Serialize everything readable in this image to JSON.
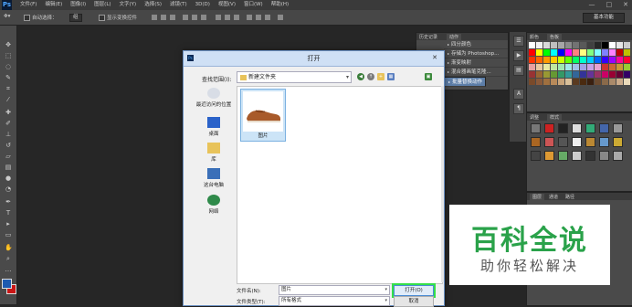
{
  "app": {
    "logo": "Ps",
    "menu": [
      "文件(F)",
      "编辑(E)",
      "图像(I)",
      "图层(L)",
      "文字(Y)",
      "选择(S)",
      "滤镜(T)",
      "3D(D)",
      "视图(V)",
      "窗口(W)",
      "帮助(H)"
    ],
    "window_controls": [
      "—",
      "□",
      "✕"
    ]
  },
  "options_bar": {
    "auto_select_label": "自动选择：",
    "auto_select_value": "组",
    "show_transform_label": "显示变换控件",
    "workspace": "基本功能"
  },
  "actions_panel": {
    "tabs": [
      "历史记录",
      "动作"
    ],
    "items": [
      {
        "label": "四分颜色",
        "selected": false
      },
      {
        "label": "存储为 Photoshop...",
        "selected": false
      },
      {
        "label": "渐变映射",
        "selected": false
      },
      {
        "label": "混合器画笔克隆...",
        "selected": false
      },
      {
        "label": "批量替换动作",
        "selected": true
      }
    ]
  },
  "swatches_panel": {
    "tabs": [
      "颜色",
      "色板"
    ],
    "colors": [
      "#ffffff",
      "#f2f2f2",
      "#d9d9d9",
      "#bfbfbf",
      "#a6a6a6",
      "#8c8c8c",
      "#737373",
      "#595959",
      "#404040",
      "#262626",
      "#000000",
      "#ffffff",
      "#e6e6e6",
      "#cccccc",
      "#ff0000",
      "#ffff00",
      "#00ff00",
      "#00ffff",
      "#0000ff",
      "#ff00ff",
      "#ff8080",
      "#ffff80",
      "#80ff80",
      "#80ffff",
      "#8080ff",
      "#ff80ff",
      "#c00000",
      "#c0c000",
      "#ff3300",
      "#ff6600",
      "#ff9900",
      "#ffcc00",
      "#ccff00",
      "#66ff00",
      "#00ff66",
      "#00ffcc",
      "#00ccff",
      "#0066ff",
      "#3300ff",
      "#9900ff",
      "#ff0099",
      "#ff0033",
      "#e8a0a0",
      "#e8c8a0",
      "#e8e8a0",
      "#c0e8a0",
      "#a0e8b0",
      "#a0e8e8",
      "#a0c0e8",
      "#a0a0e8",
      "#c8a0e8",
      "#e8a0d0",
      "#cc3333",
      "#cc6633",
      "#cc9933",
      "#99cc33",
      "#993333",
      "#996633",
      "#999933",
      "#669933",
      "#339966",
      "#339999",
      "#336699",
      "#333399",
      "#663399",
      "#993366",
      "#cc0066",
      "#990033",
      "#660033",
      "#330066",
      "#7a4a2a",
      "#8a5a3a",
      "#a0703f",
      "#b88a5a",
      "#c8a47a",
      "#d9c09a",
      "#5a3a20",
      "#4a2a10",
      "#3a2010",
      "#6a4a30",
      "#8a6a4a",
      "#aa8a6a",
      "#caaa8a",
      "#eadaba"
    ]
  },
  "styles_panel": {
    "tabs": [
      "调整",
      "样式"
    ]
  },
  "layers_panel": {
    "tabs": [
      "图层",
      "通道",
      "路径"
    ]
  },
  "dialog": {
    "title": "打开",
    "close": "✕",
    "look_in_label": "查找范围(I):",
    "look_in_value": "新建文件夹",
    "places": [
      {
        "label": "最近访问的位置",
        "icon": "recent-places-icon"
      },
      {
        "label": "桌面",
        "icon": "desktop-icon"
      },
      {
        "label": "库",
        "icon": "libraries-icon"
      },
      {
        "label": "这台电脑",
        "icon": "computer-icon"
      },
      {
        "label": "网络",
        "icon": "network-icon"
      }
    ],
    "files": [
      {
        "name": "图片",
        "type": "image-thumbnail",
        "selected": true
      }
    ],
    "filename_label": "文件名(N):",
    "filename_value": "图片",
    "filetype_label": "文件类型(T):",
    "filetype_value": "所有格式",
    "open_button": "打开(O)",
    "cancel_button": "取消"
  },
  "watermark": {
    "title": "百科全说",
    "subtitle": "助你轻松解决"
  }
}
